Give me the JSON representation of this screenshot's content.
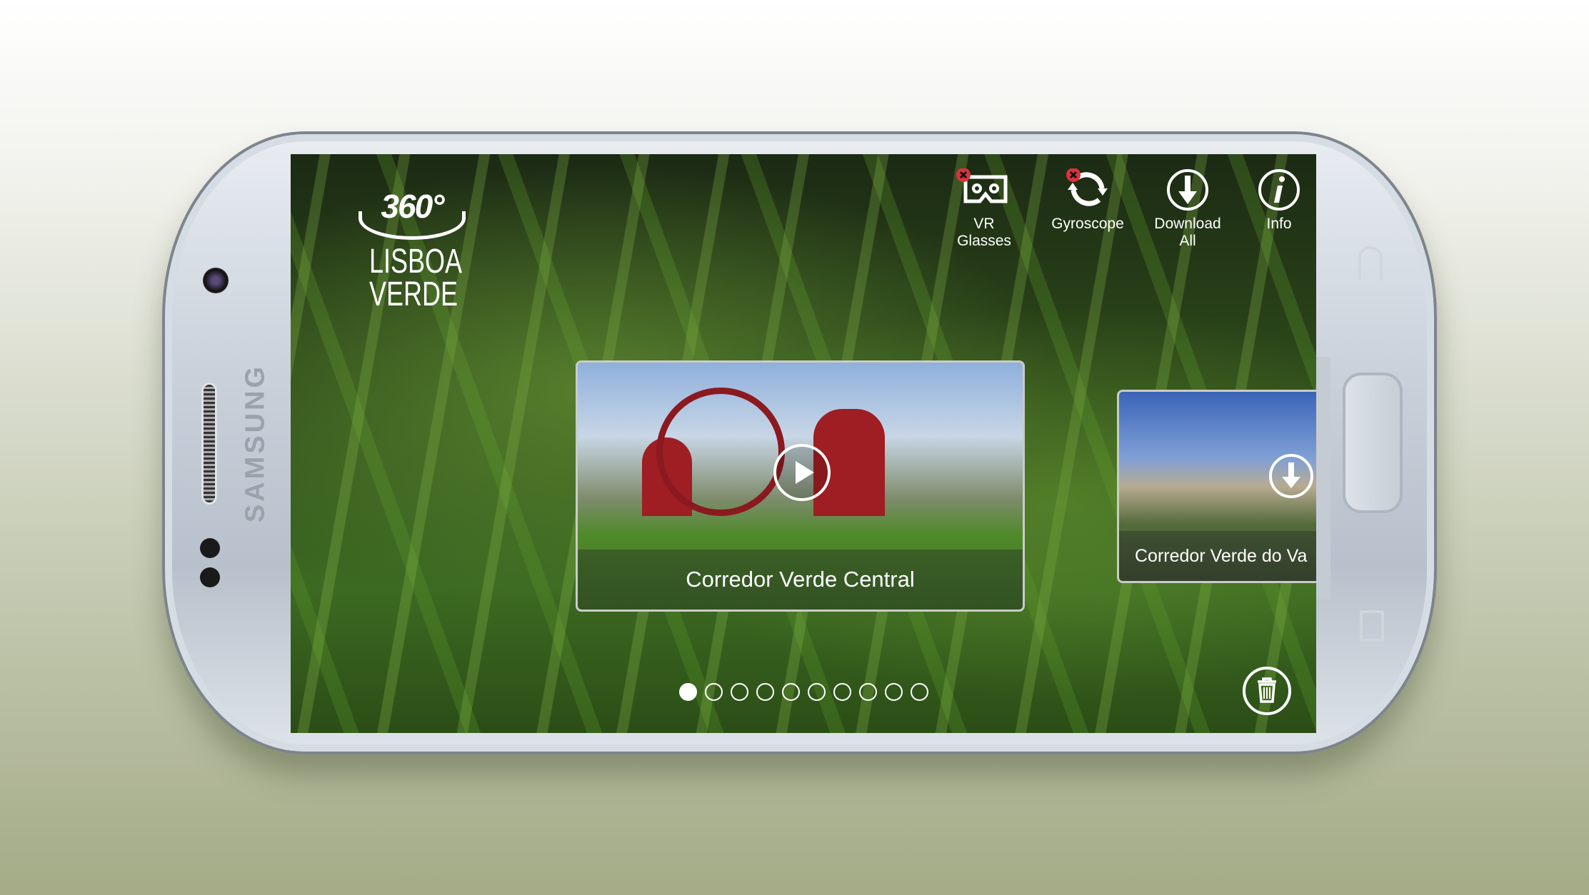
{
  "device": {
    "brand": "SAMSUNG"
  },
  "logo": {
    "badge": "360°",
    "line1": "LISBOA",
    "line2": "VERDE"
  },
  "toolbar": [
    {
      "label1": "VR",
      "label2": "Glasses",
      "icon": "vr-glasses-icon",
      "disabled": true
    },
    {
      "label1": "Gyroscope",
      "label2": "",
      "icon": "gyroscope-rotate-icon",
      "disabled": true
    },
    {
      "label1": "Download",
      "label2": "All",
      "icon": "download-circle-icon"
    },
    {
      "label1": "Info",
      "label2": "",
      "icon": "info-circle-icon"
    }
  ],
  "cards": [
    {
      "title": "Corredor Verde Central",
      "action": "play"
    },
    {
      "title": "Corredor Verde do Va",
      "action": "download"
    }
  ],
  "pager": {
    "count": 10,
    "active": 1
  },
  "colors": {
    "disabled_badge": "#d8333b",
    "accent": "#ffffff"
  }
}
